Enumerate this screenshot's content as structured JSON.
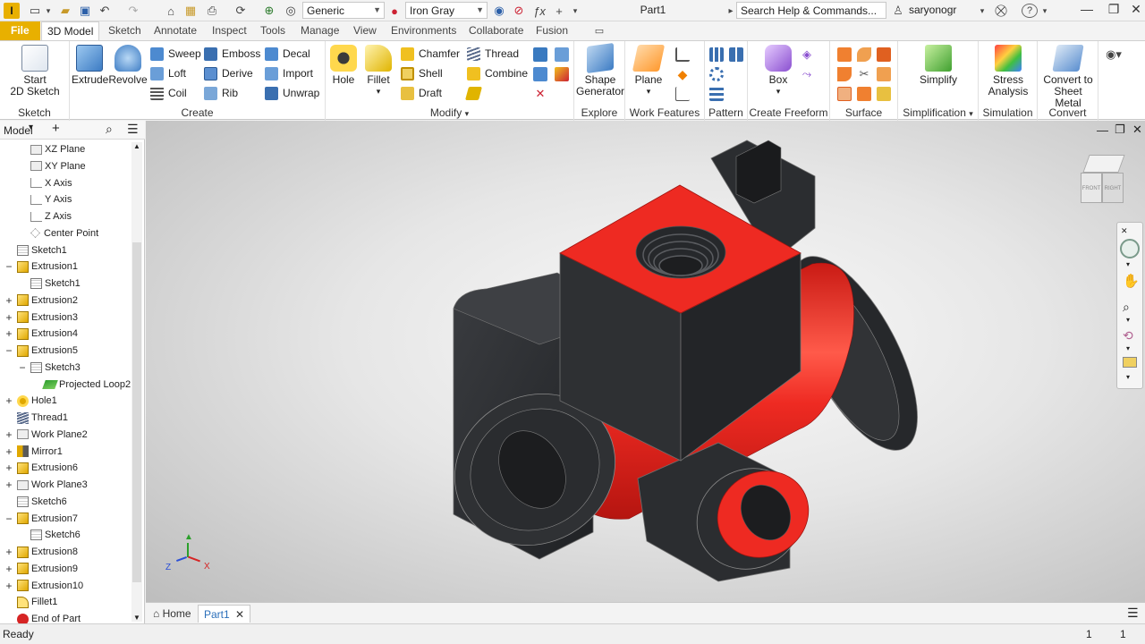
{
  "titlebar": {
    "logo": "I",
    "material": "Generic",
    "appearance": "Iron Gray",
    "document_title": "Part1",
    "search_placeholder": "Search Help & Commands...",
    "user": "saryonogr",
    "help": "?",
    "minimize": "—",
    "restore": "❐",
    "close": "✕"
  },
  "tabs": [
    "File",
    "3D Model",
    "Sketch",
    "Annotate",
    "Inspect",
    "Tools",
    "Manage",
    "View",
    "Environments",
    "Collaborate",
    "Fusion"
  ],
  "ribbon": {
    "sketch": {
      "label": "Sketch",
      "start_sketch": "Start",
      "start_sketch2": "2D Sketch"
    },
    "create": {
      "label": "Create",
      "extrude": "Extrude",
      "revolve": "Revolve",
      "sweep": "Sweep",
      "loft": "Loft",
      "coil": "Coil",
      "emboss": "Emboss",
      "derive": "Derive",
      "rib": "Rib",
      "decal": "Decal",
      "import": "Import",
      "unwrap": "Unwrap"
    },
    "modify": {
      "label": "Modify",
      "hole": "Hole",
      "fillet": "Fillet",
      "chamfer": "Chamfer",
      "shell": "Shell",
      "draft": "Draft",
      "thread": "Thread",
      "combine": "Combine"
    },
    "explore": {
      "label": "Explore",
      "shape_generator": "Shape",
      "shape_generator2": "Generator"
    },
    "work_features": {
      "label": "Work Features",
      "plane": "Plane"
    },
    "pattern": {
      "label": "Pattern"
    },
    "freeform": {
      "label": "Create Freeform",
      "box": "Box"
    },
    "surface": {
      "label": "Surface"
    },
    "simplification": {
      "label": "Simplification",
      "simplify": "Simplify"
    },
    "simulation": {
      "label": "Simulation",
      "stress": "Stress",
      "stress2": "Analysis"
    },
    "convert": {
      "label": "Convert",
      "sheet_metal": "Convert to",
      "sheet_metal2": "Sheet Metal"
    }
  },
  "browser": {
    "title": "Model",
    "add": "+",
    "items": [
      {
        "label": "XZ Plane",
        "icon": "plane-icon",
        "indent": 1,
        "expander": ""
      },
      {
        "label": "XY Plane",
        "icon": "plane-icon",
        "indent": 1,
        "expander": ""
      },
      {
        "label": "X Axis",
        "icon": "axis-icon",
        "indent": 1,
        "expander": ""
      },
      {
        "label": "Y Axis",
        "icon": "axis-icon",
        "indent": 1,
        "expander": ""
      },
      {
        "label": "Z Axis",
        "icon": "axis-icon",
        "indent": 1,
        "expander": ""
      },
      {
        "label": "Center Point",
        "icon": "point-icon",
        "indent": 1,
        "expander": ""
      },
      {
        "label": "Sketch1",
        "icon": "sketch-icon",
        "indent": 0,
        "expander": ""
      },
      {
        "label": "Extrusion1",
        "icon": "extrude-icon",
        "indent": 0,
        "expander": "−"
      },
      {
        "label": "Sketch1",
        "icon": "sketch-icon",
        "indent": 1,
        "expander": ""
      },
      {
        "label": "Extrusion2",
        "icon": "extrude-icon",
        "indent": 0,
        "expander": "+"
      },
      {
        "label": "Extrusion3",
        "icon": "extrude-icon",
        "indent": 0,
        "expander": "+"
      },
      {
        "label": "Extrusion4",
        "icon": "extrude-icon",
        "indent": 0,
        "expander": "+"
      },
      {
        "label": "Extrusion5",
        "icon": "extrude-icon",
        "indent": 0,
        "expander": "−"
      },
      {
        "label": "Sketch3",
        "icon": "sketch-icon",
        "indent": 1,
        "expander": "−"
      },
      {
        "label": "Projected Loop2",
        "icon": "loop-icon",
        "indent": 2,
        "expander": ""
      },
      {
        "label": "Hole1",
        "icon": "hole-icon",
        "indent": 0,
        "expander": "+"
      },
      {
        "label": "Thread1",
        "icon": "thread-icon",
        "indent": 0,
        "expander": ""
      },
      {
        "label": "Work Plane2",
        "icon": "plane-icon",
        "indent": 0,
        "expander": "+"
      },
      {
        "label": "Mirror1",
        "icon": "mirror-icon",
        "indent": 0,
        "expander": "+"
      },
      {
        "label": "Extrusion6",
        "icon": "extrude-icon",
        "indent": 0,
        "expander": "+"
      },
      {
        "label": "Work Plane3",
        "icon": "plane-icon",
        "indent": 0,
        "expander": "+"
      },
      {
        "label": "Sketch6",
        "icon": "sketch-icon",
        "indent": 0,
        "expander": ""
      },
      {
        "label": "Extrusion7",
        "icon": "extrude-icon",
        "indent": 0,
        "expander": "−"
      },
      {
        "label": "Sketch6",
        "icon": "sketch-icon",
        "indent": 1,
        "expander": ""
      },
      {
        "label": "Extrusion8",
        "icon": "extrude-icon",
        "indent": 0,
        "expander": "+"
      },
      {
        "label": "Extrusion9",
        "icon": "extrude-icon",
        "indent": 0,
        "expander": "+"
      },
      {
        "label": "Extrusion10",
        "icon": "extrude-icon",
        "indent": 0,
        "expander": "+"
      },
      {
        "label": "Fillet1",
        "icon": "fillet-icon",
        "indent": 0,
        "expander": ""
      },
      {
        "label": "End of Part",
        "icon": "end-icon",
        "indent": 0,
        "expander": ""
      }
    ]
  },
  "viewport": {
    "viewcube_front": "FRONT",
    "viewcube_right": "RIGHT",
    "axis_x": "X",
    "axis_y": "Y",
    "axis_z": "Z",
    "model_dark_color": "#2b2d30",
    "model_red_color": "#ee2a22"
  },
  "doc_tabs": {
    "home": "Home",
    "part": "Part1"
  },
  "status": {
    "text": "Ready",
    "count1": "1",
    "count2": "1"
  }
}
